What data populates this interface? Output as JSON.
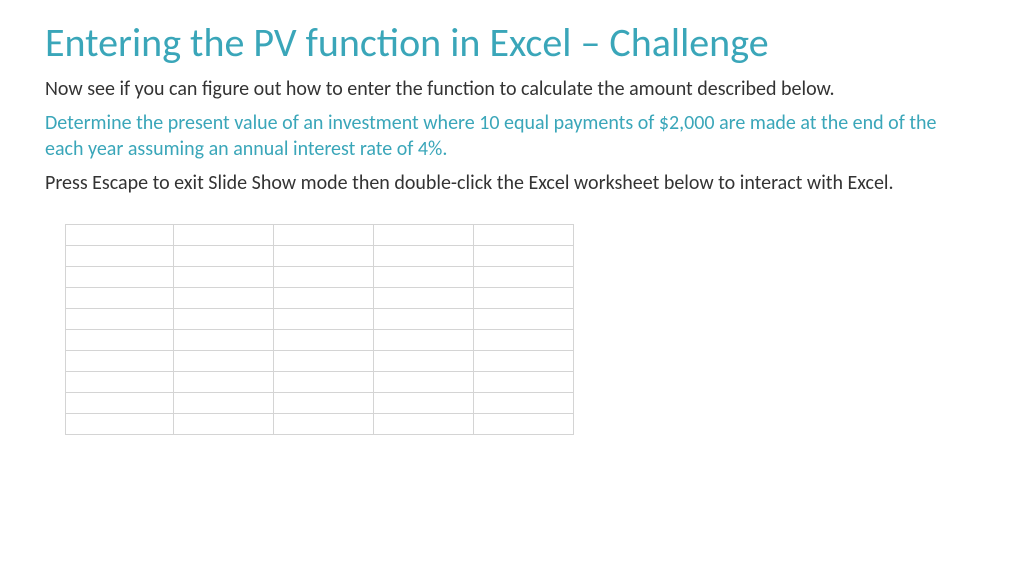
{
  "title": "Entering the PV function in Excel – Challenge",
  "paragraphs": {
    "intro": "Now see if you can figure out how to enter the function to calculate the amount described below.",
    "problem": "Determine the present value of an investment where 10 equal payments of $2,000 are made at the end of the each year assuming an annual interest rate of 4%.",
    "instruction": "Press Escape to exit Slide Show mode then double-click the Excel worksheet below to interact with Excel."
  },
  "worksheet": {
    "rows": 10,
    "cols": 5
  }
}
